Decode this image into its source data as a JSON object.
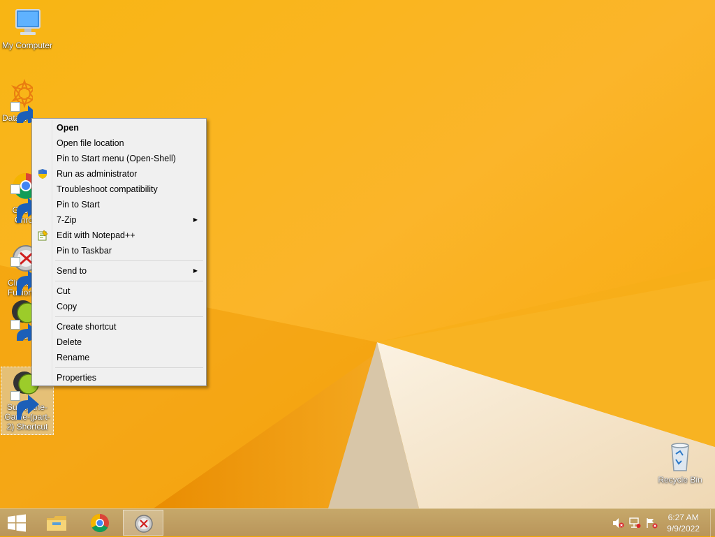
{
  "colors": {
    "wallpaper_base": "#f5a800",
    "wallpaper_light": "#fbc23a",
    "wallpaper_dark": "#e57f00",
    "wallpaper_cream": "#f4e6cf",
    "menu_bg": "#f0f0f0",
    "taskbar": "#c0a064"
  },
  "desktop": {
    "icons": [
      {
        "label": "My Computer",
        "icon": "my-computer-icon"
      },
      {
        "label": "DataWa",
        "icon": "datawarrior-icon"
      },
      {
        "label": "Goog\nChro",
        "icon": "chrome-icon"
      },
      {
        "label": "Clickte\nFusion",
        "icon": "clickteam-fusion-icon"
      },
      {
        "label": "Sun",
        "icon": "sunky-game-icon"
      },
      {
        "label": "Sunky-the-Game-(part-2) Shortcut",
        "icon": "sunky-game-icon"
      },
      {
        "label": "Recycle Bin",
        "icon": "recycle-bin-icon"
      }
    ]
  },
  "context_menu": {
    "items": [
      {
        "label": "Open",
        "bold": true
      },
      {
        "label": "Open file location"
      },
      {
        "label": "Pin to Start menu (Open-Shell)"
      },
      {
        "label": "Run as administrator",
        "icon": "uac-shield-icon"
      },
      {
        "label": "Troubleshoot compatibility"
      },
      {
        "label": "Pin to Start"
      },
      {
        "label": "7-Zip",
        "submenu": true
      },
      {
        "label": "Edit with Notepad++",
        "icon": "notepad-plus-plus-icon"
      },
      {
        "label": "Pin to Taskbar"
      },
      {
        "label": "Send to",
        "submenu": true
      },
      {
        "label": "Cut"
      },
      {
        "label": "Copy"
      },
      {
        "label": "Create shortcut"
      },
      {
        "label": "Delete"
      },
      {
        "label": "Rename"
      },
      {
        "label": "Properties"
      }
    ]
  },
  "taskbar": {
    "start_icon": "windows-logo-icon",
    "pinned": [
      {
        "name": "File Explorer",
        "icon": "file-explorer-icon"
      },
      {
        "name": "Google Chrome",
        "icon": "chrome-icon"
      },
      {
        "name": "Clickteam Fusion",
        "icon": "clickteam-fusion-icon",
        "active": true
      }
    ],
    "tray_icons": [
      "volume-muted-icon",
      "network-icon",
      "action-center-icon"
    ],
    "clock": {
      "time": "6:27 AM",
      "date": "9/9/2022"
    }
  }
}
